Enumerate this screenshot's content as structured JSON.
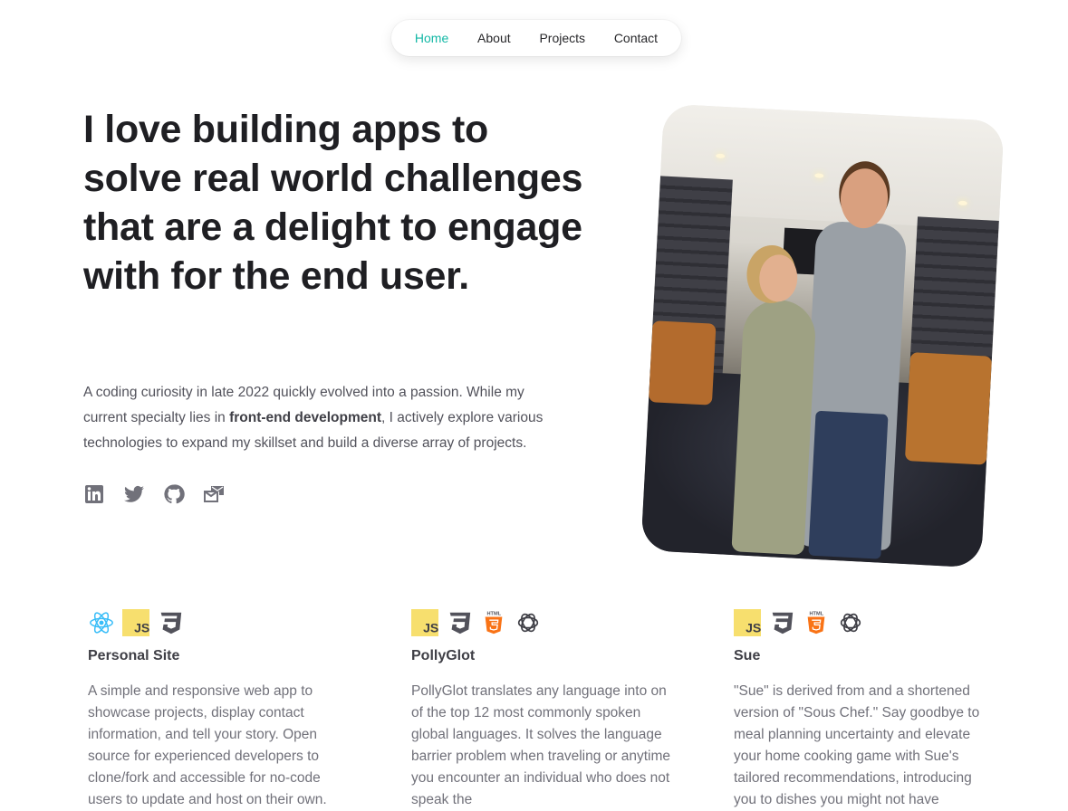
{
  "nav": {
    "items": [
      {
        "label": "Home",
        "active": true
      },
      {
        "label": "About",
        "active": false
      },
      {
        "label": "Projects",
        "active": false
      },
      {
        "label": "Contact",
        "active": false
      }
    ],
    "accent_color": "#14b8a6"
  },
  "hero": {
    "title": "I love building apps to solve real world challenges that are a delight to engage with for the end user.",
    "intro_before": "A coding curiosity in late 2022 quickly evolved into a passion. While my current specialty lies in ",
    "intro_highlight": "front-end development",
    "intro_after": ", I actively explore various technologies to expand my skillset and build a diverse array of projects."
  },
  "socials": [
    {
      "icon": "linkedin-icon"
    },
    {
      "icon": "twitter-icon"
    },
    {
      "icon": "github-icon"
    },
    {
      "icon": "mail-icon"
    }
  ],
  "projects": [
    {
      "tech": [
        "react-icon",
        "javascript-icon",
        "css3-icon"
      ],
      "title": "Personal Site",
      "description": "A simple and responsive web app to showcase projects, display contact information, and tell your story. Open source for experienced developers to clone/fork and accessible for no-code users to update and host on their own."
    },
    {
      "tech": [
        "javascript-icon",
        "css3-icon",
        "html5-icon",
        "openai-icon"
      ],
      "title": "PollyGlot",
      "description": "PollyGlot translates any language into on of the top 12 most commonly spoken global languages. It solves the language barrier problem when traveling or anytime you encounter an individual who does not speak the"
    },
    {
      "tech": [
        "javascript-icon",
        "css3-icon",
        "html5-icon",
        "openai-icon"
      ],
      "title": "Sue",
      "description": "\"Sue\" is derived from and a shortened version of \"Sous Chef.\" Say goodbye to meal planning uncertainty and elevate your home cooking game with Sue's tailored recommendations, introducing you to dishes you might not have"
    }
  ]
}
